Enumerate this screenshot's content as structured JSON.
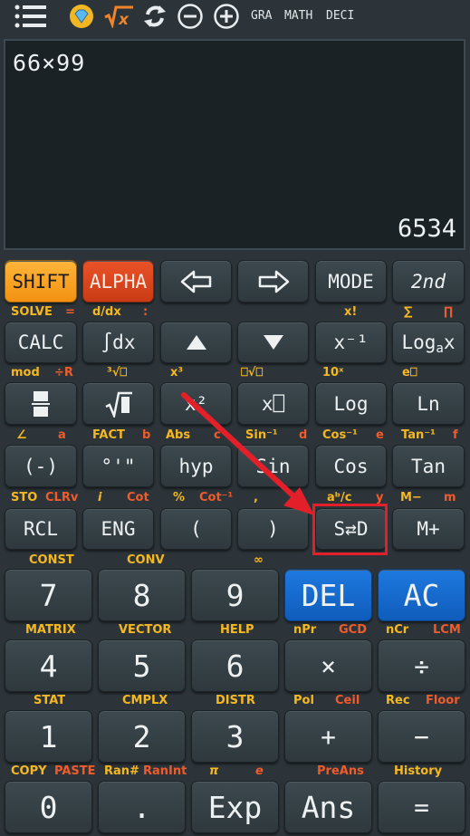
{
  "toolbar": {
    "gra": "GRA",
    "math": "MATH",
    "deci": "DECI"
  },
  "display": {
    "expression": "66×99",
    "result": "6534"
  },
  "row1": {
    "shift": "SHIFT",
    "alpha": "ALPHA",
    "mode": "MODE",
    "second": "2nd"
  },
  "labels1": {
    "solve": "SOLVE",
    "eq": "=",
    "ddx": "d/dx",
    "colon": ":",
    "xfact": "x!",
    "sum": "∑",
    "prod": "∏"
  },
  "row2": {
    "calc": "CALC",
    "integral": "∫dx",
    "xinv": "x⁻¹",
    "log_base": "Log",
    "log_sub": "a",
    "log_x": "x"
  },
  "labels2": {
    "mod": "mod",
    "divr": "÷R",
    "cuberoot": "³√⎕",
    "x3": "x³",
    "nroot": "⎕√⎕",
    "tenx": "10ˣ",
    "ex": "e⎕"
  },
  "row3": {
    "xsq": "x²",
    "xbox": "x⎕",
    "log": "Log",
    "ln": "Ln"
  },
  "labels3": {
    "angle": "∠",
    "a": "a",
    "fact": "FACT",
    "b": "b",
    "abs": "Abs",
    "c": "c",
    "sininv": "Sin⁻¹",
    "d": "d",
    "cosinv": "Cos⁻¹",
    "e": "e",
    "taninv": "Tan⁻¹",
    "f": "f"
  },
  "row4": {
    "neg": "(-)",
    "dms": "°'\"",
    "hyp": "hyp",
    "sin": "Sin",
    "cos": "Cos",
    "tan": "Tan"
  },
  "labels4": {
    "sto": "STO",
    "clrv": "CLRv",
    "i": "i",
    "cot": "Cot",
    "pct": "%",
    "cotinv": "Cot⁻¹",
    "comma": ",",
    "abc": "aᵇ/c",
    "yv": "y",
    "mminus": "M−",
    "m": "m"
  },
  "row5": {
    "rcl": "RCL",
    "eng": "ENG",
    "lparen": "(",
    "rparen": ")",
    "sd": "S⇄D",
    "mplus": "M+"
  },
  "labels5": {
    "const": "CONST",
    "conv": "CONV",
    "inf": "∞"
  },
  "row6": {
    "seven": "7",
    "eight": "8",
    "nine": "9",
    "del": "DEL",
    "ac": "AC"
  },
  "labels6": {
    "matrix": "MATRIX",
    "vector": "VECTOR",
    "help": "HELP",
    "npr": "nPr",
    "gcd": "GCD",
    "ncr": "nCr",
    "lcm": "LCM"
  },
  "row7": {
    "four": "4",
    "five": "5",
    "six": "6",
    "mul": "×",
    "div": "÷"
  },
  "labels7": {
    "stat": "STAT",
    "cmplx": "CMPLX",
    "distr": "DISTR",
    "pol": "Pol",
    "ceil": "Ceil",
    "rec": "Rec",
    "floor": "Floor"
  },
  "row8": {
    "one": "1",
    "two": "2",
    "three": "3",
    "plus": "+",
    "minus": "−"
  },
  "labels8": {
    "copy": "COPY",
    "paste": "PASTE",
    "rannum": "Ran#",
    "ranint": "RanInt",
    "pi": "π",
    "e": "e",
    "preans": "PreAns",
    "history": "History"
  },
  "row9": {
    "zero": "0",
    "dot": ".",
    "exp": "Exp",
    "ans": "Ans",
    "equals": "="
  },
  "colors": {
    "shift": "#f29112",
    "alpha": "#c93b15",
    "del": "#1e79df",
    "label_yellow": "#f6b820",
    "label_red": "#ef5b2a",
    "highlight": "#e3202a"
  }
}
